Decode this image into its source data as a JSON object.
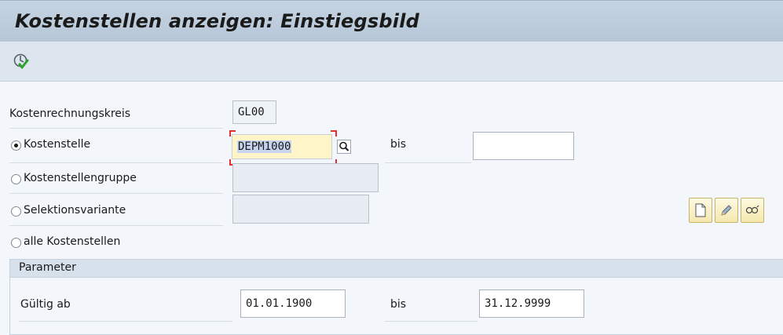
{
  "window": {
    "title": "Kostenstellen anzeigen: Einstiegsbild"
  },
  "toolbar": {
    "execute_icon": "execute-icon"
  },
  "form": {
    "controlling_area": {
      "label": "Kostenrechnungskreis",
      "value": "GL00"
    },
    "cost_center": {
      "label": "Kostenstelle",
      "value": "DEPM1000",
      "to_label": "bis",
      "to_value": "",
      "selected": true
    },
    "cost_center_group": {
      "label": "Kostenstellengruppe",
      "value": ""
    },
    "selection_variant": {
      "label": "Selektionsvariante",
      "value": ""
    },
    "all_cost_centers": {
      "label": "alle Kostenstellen"
    }
  },
  "variant_buttons": [
    "create-icon",
    "edit-icon",
    "display-icon"
  ],
  "parameter": {
    "header": "Parameter",
    "valid_from": {
      "label": "Gültig ab",
      "value": "01.01.1900",
      "to_label": "bis",
      "to_value": "31.12.9999"
    }
  },
  "colors": {
    "title_bar": "#b7c7d8",
    "active_field": "#fff5c8",
    "background": "#f3f6fa"
  }
}
